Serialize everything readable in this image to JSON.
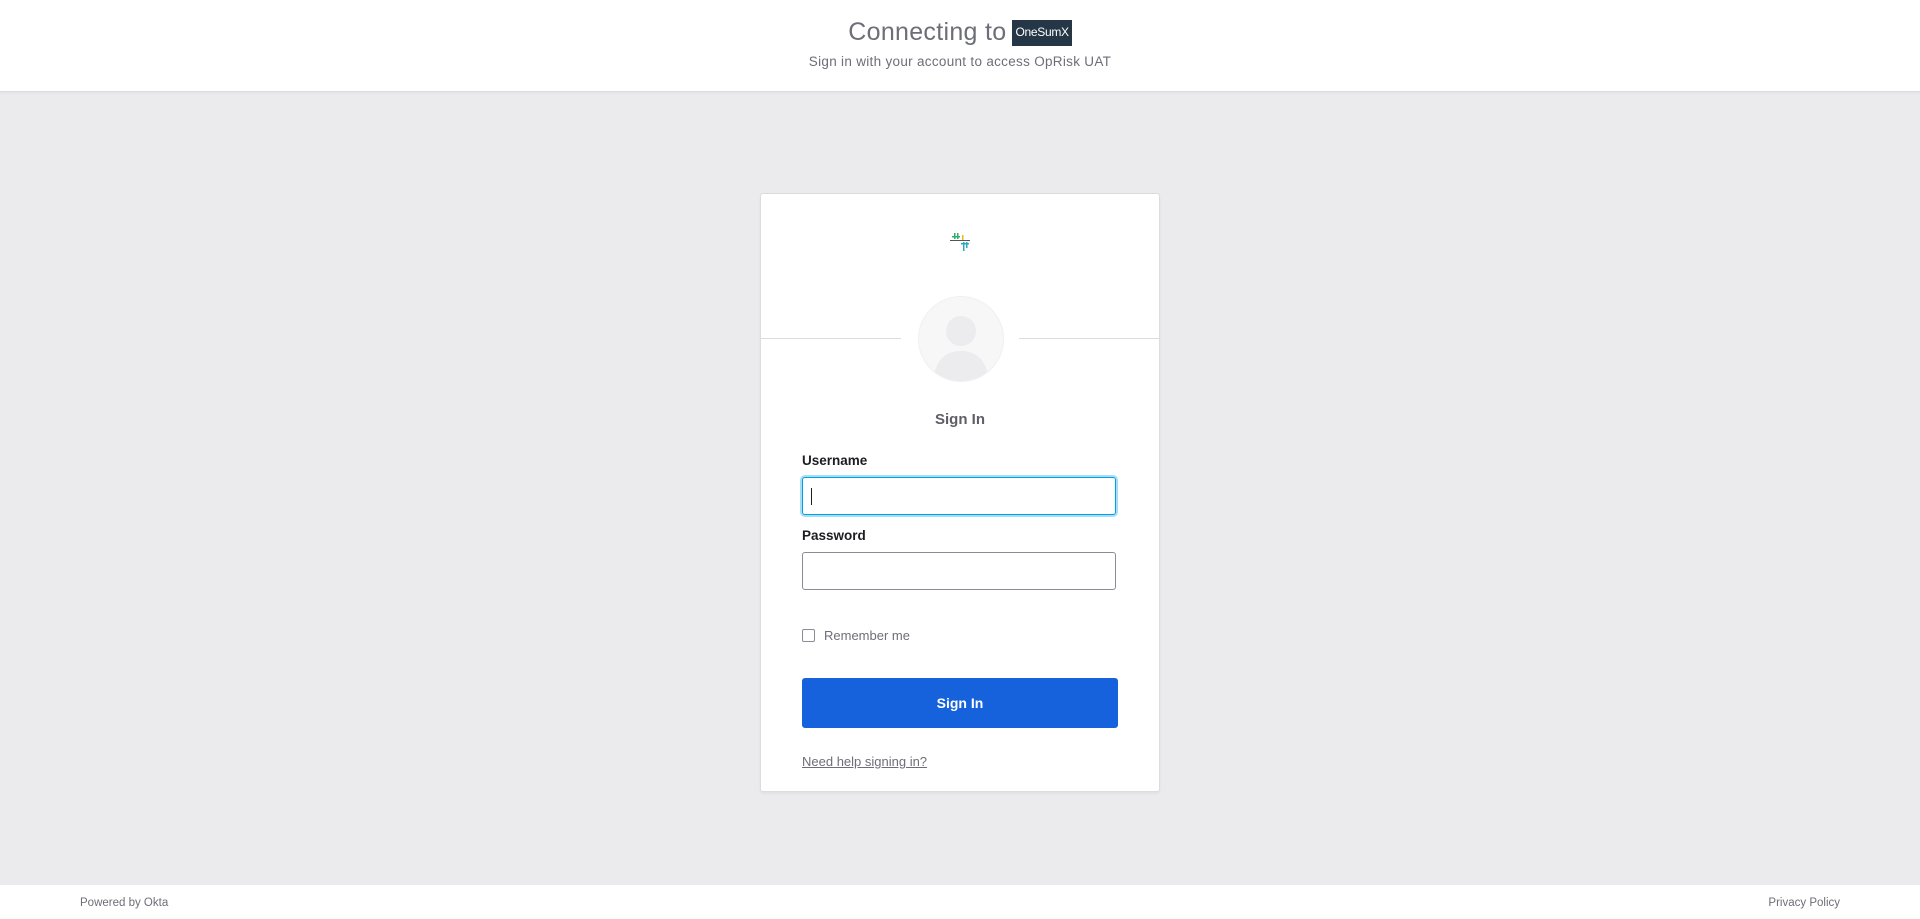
{
  "header": {
    "connecting_text": "Connecting to",
    "app_logo_text": "OneSumX",
    "subtitle": "Sign in with your account to access OpRisk UAT"
  },
  "card": {
    "title": "Sign In",
    "username": {
      "label": "Username",
      "value": ""
    },
    "password": {
      "label": "Password",
      "value": ""
    },
    "remember": {
      "label": "Remember me",
      "checked": false
    },
    "submit_label": "Sign In",
    "help_link": "Need help signing in?"
  },
  "footer": {
    "powered_by": "Powered by Okta",
    "privacy": "Privacy Policy"
  },
  "colors": {
    "accent": "#1662dd",
    "focus_ring": "#00a0e6",
    "background": "#ebebed",
    "app_logo_bg": "#253746"
  }
}
